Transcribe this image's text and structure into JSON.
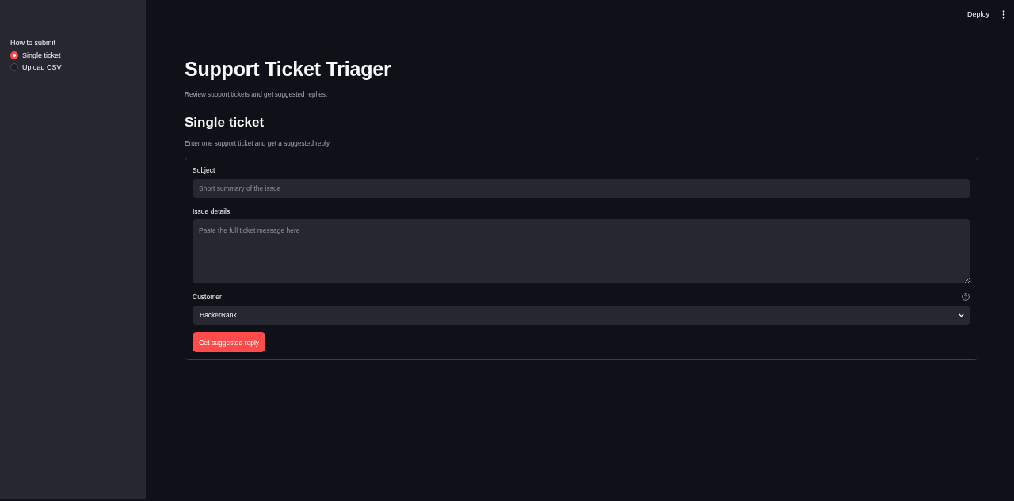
{
  "header": {
    "deploy": "Deploy"
  },
  "sidebar": {
    "radio_group": {
      "label": "How to submit",
      "options": [
        {
          "label": "Single ticket",
          "selected": true
        },
        {
          "label": "Upload CSV",
          "selected": false
        }
      ]
    }
  },
  "main": {
    "title": "Support Ticket Triager",
    "subtitle": "Review support tickets and get suggested replies.",
    "section": {
      "heading": "Single ticket",
      "description": "Enter one support ticket and get a suggested reply."
    },
    "form": {
      "fields": [
        {
          "kind": "text",
          "label": "Subject",
          "placeholder": "Short summary of the issue",
          "help": false
        },
        {
          "kind": "textarea",
          "label": "Issue details",
          "placeholder": "Paste the full ticket message here",
          "help": false
        },
        {
          "kind": "select",
          "label": "Customer",
          "value": "HackerRank",
          "help": true
        }
      ],
      "submit": "Get suggested reply"
    }
  }
}
